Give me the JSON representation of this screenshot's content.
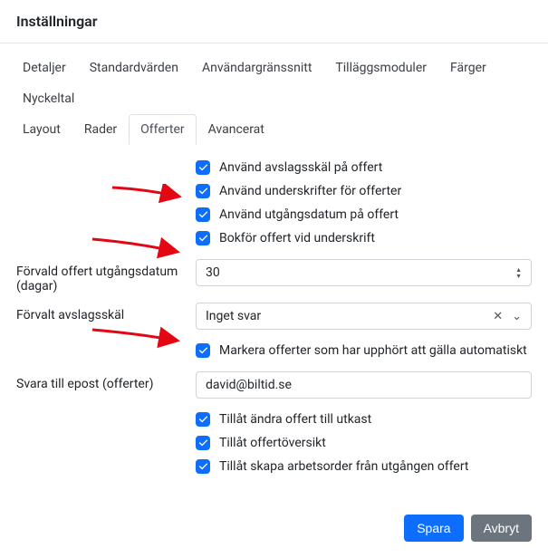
{
  "title": "Inställningar",
  "tabs_row1": [
    "Detaljer",
    "Standardvärden",
    "Användargränssnitt",
    "Tilläggsmoduler",
    "Färger",
    "Nyckeltal"
  ],
  "tabs_row2": [
    "Layout",
    "Rader",
    "Offerter",
    "Avancerat"
  ],
  "active_tab": "Offerter",
  "checks_top": [
    "Använd avslagsskäl på offert",
    "Använd underskrifter för offerter",
    "Använd utgångsdatum på offert",
    "Bokför offert vid underskrift"
  ],
  "expiry_label": "Förvald offert utgångsdatum (dagar)",
  "expiry_value": "30",
  "reason_label": "Förvalt avslagsskäl",
  "reason_value": "Inget svar",
  "auto_mark": "Markera offerter som har upphört att gälla automatiskt",
  "reply_label": "Svara till epost (offerter)",
  "reply_value": "david@biltid.se",
  "checks_bottom": [
    "Tillåt ändra offert till utkast",
    "Tillåt offertöversikt",
    "Tillåt skapa arbetsorder från utgången offert"
  ],
  "save": "Spara",
  "cancel": "Avbryt"
}
